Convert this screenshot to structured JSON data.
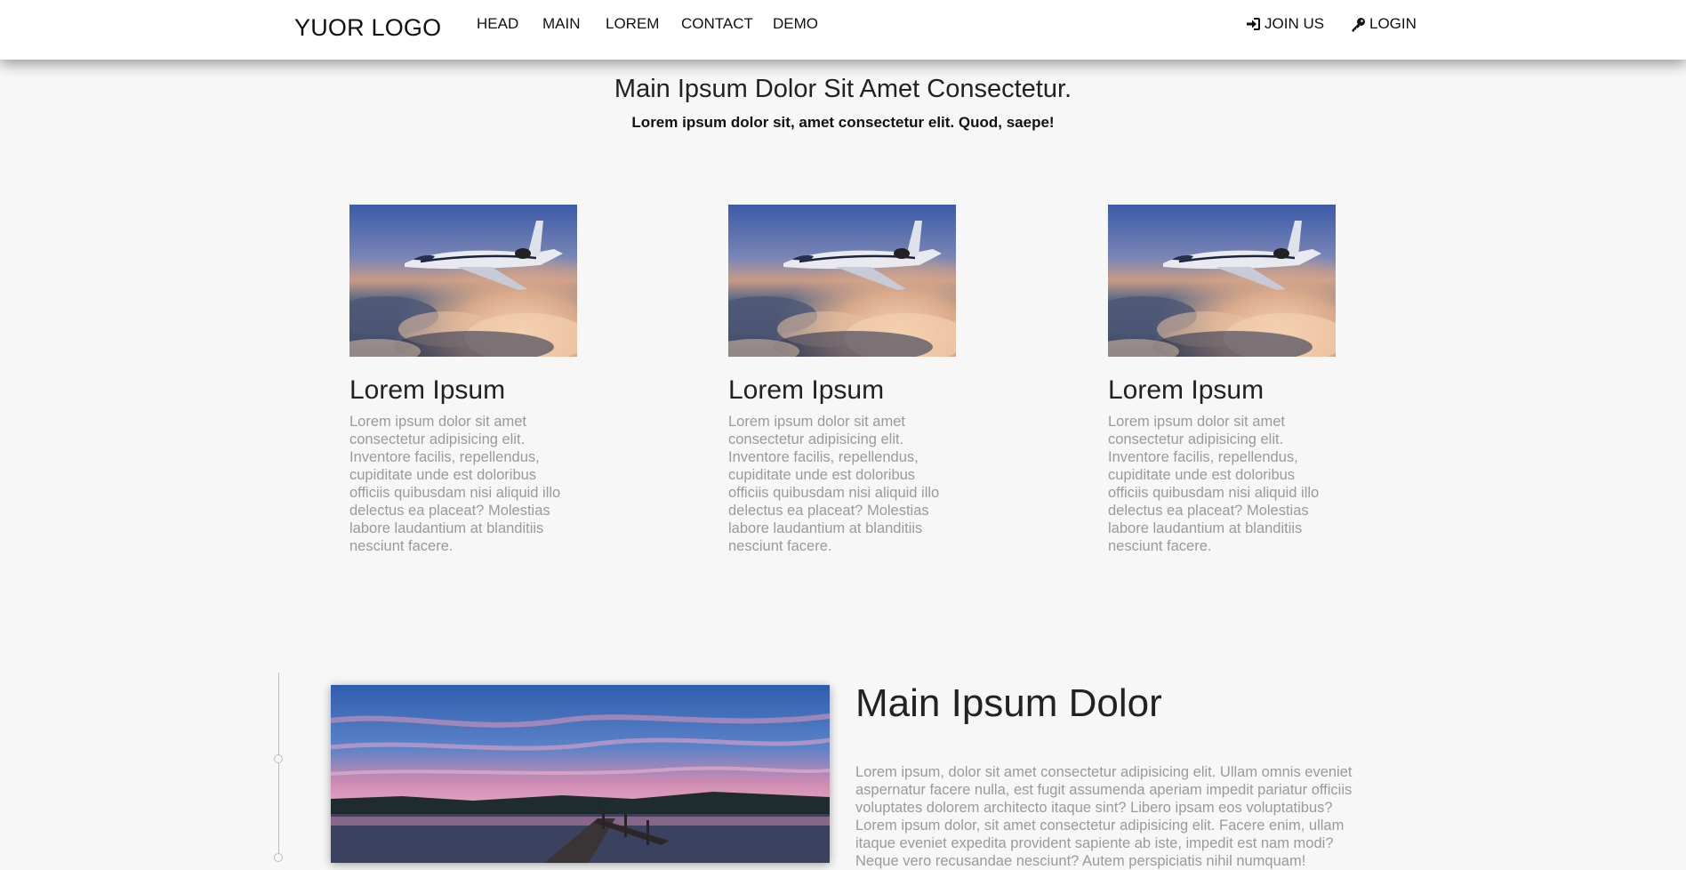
{
  "header": {
    "logo": "YUOR LOGO",
    "nav": [
      "HEAD",
      "MAIN",
      "LOREM",
      "CONTACT",
      "DEMO"
    ],
    "join_label": "JOIN US",
    "login_label": "LOGIN",
    "join_icon": "sign-in-icon",
    "login_icon": "key-icon"
  },
  "intro": {
    "title": "Main Ipsum Dolor Sit Amet Consectetur.",
    "subtitle": "Lorem ipsum dolor sit, amet consectetur elit. Quod, saepe!"
  },
  "cards": [
    {
      "image": "airplane-above-clouds",
      "title": "Lorem Ipsum",
      "text": "Lorem ipsum dolor sit amet consectetur adipisicing elit. Inventore facilis, repellendus, cupiditate unde est doloribus officiis quibusdam nisi aliquid illo delectus ea placeat? Molestias labore laudantium at blanditiis nesciunt facere."
    },
    {
      "image": "airplane-above-clouds",
      "title": "Lorem Ipsum",
      "text": "Lorem ipsum dolor sit amet consectetur adipisicing elit. Inventore facilis, repellendus, cupiditate unde est doloribus officiis quibusdam nisi aliquid illo delectus ea placeat? Molestias labore laudantium at blanditiis nesciunt facere."
    },
    {
      "image": "airplane-above-clouds",
      "title": "Lorem Ipsum",
      "text": "Lorem ipsum dolor sit amet consectetur adipisicing elit. Inventore facilis, repellendus, cupiditate unde est doloribus officiis quibusdam nisi aliquid illo delectus ea placeat? Molestias labore laudantium at blanditiis nesciunt facere."
    }
  ],
  "feature": {
    "image": "lake-pier-sunset",
    "title": "Main Ipsum Dolor",
    "text": "Lorem ipsum, dolor sit amet consectetur adipisicing elit. Ullam omnis eveniet aspernatur facere nulla, est fugit assumenda aperiam impedit pariatur officiis voluptates dolorem architecto itaque sint? Libero ipsam eos voluptatibus? Lorem ipsum dolor, sit amet consectetur adipisicing elit. Facere enim, ullam itaque eveniet expedita provident sapiente ab iste, impedit est nam modi? Neque vero recusandae nesciunt? Autem perspiciatis nihil numquam!"
  },
  "colors": {
    "background": "#f7f7f7",
    "body_text": "#9a9a9a",
    "heading_text": "#222222"
  }
}
